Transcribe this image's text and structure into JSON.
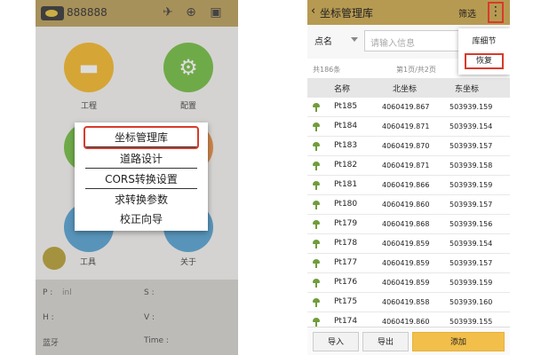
{
  "left": {
    "title": "888888",
    "grid": [
      {
        "label": "工程",
        "color": "#f4b420"
      },
      {
        "label": "配置",
        "color": "#6dbb3a"
      },
      {
        "label": "工具",
        "color": "#4e9ed1"
      },
      {
        "label": "关于",
        "color": "#4e9ed1"
      }
    ],
    "info": {
      "p": "P :",
      "p_val": "inl",
      "s": "S :",
      "h": "H :",
      "v": "V :",
      "bt": "蓝牙",
      "time": "Time :"
    },
    "popup": [
      "坐标管理库",
      "道路设计",
      "CORS转换设置",
      "求转换参数",
      "校正向导"
    ]
  },
  "right": {
    "title": "坐标管理库",
    "filter": "筛选",
    "search": {
      "field": "点名",
      "placeholder": "请输入信息"
    },
    "menu": [
      "库细节",
      "恢复"
    ],
    "count": "共186条",
    "page": "第1页/共2页",
    "columns": [
      "名称",
      "北坐标",
      "东坐标"
    ],
    "rows": [
      [
        "Pt185",
        "4060419.867",
        "503939.159"
      ],
      [
        "Pt184",
        "4060419.871",
        "503939.154"
      ],
      [
        "Pt183",
        "4060419.870",
        "503939.157"
      ],
      [
        "Pt182",
        "4060419.871",
        "503939.158"
      ],
      [
        "Pt181",
        "4060419.866",
        "503939.159"
      ],
      [
        "Pt180",
        "4060419.860",
        "503939.157"
      ],
      [
        "Pt179",
        "4060419.868",
        "503939.156"
      ],
      [
        "Pt178",
        "4060419.859",
        "503939.154"
      ],
      [
        "Pt177",
        "4060419.859",
        "503939.157"
      ],
      [
        "Pt176",
        "4060419.859",
        "503939.159"
      ],
      [
        "Pt175",
        "4060419.858",
        "503939.160"
      ],
      [
        "Pt174",
        "4060419.860",
        "503939.155"
      ]
    ],
    "buttons": {
      "import": "导入",
      "export": "导出",
      "add": "添加"
    }
  },
  "colors": {
    "brand": "#b79a52",
    "highlight": "#d93a2b",
    "pin": "#6f9d3b",
    "add": "#f2bf4b"
  }
}
